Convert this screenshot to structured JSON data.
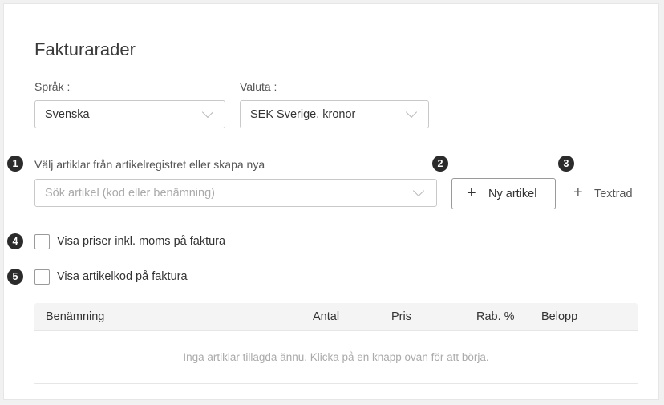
{
  "title": "Fakturarader",
  "language": {
    "label": "Språk :",
    "value": "Svenska"
  },
  "currency": {
    "label": "Valuta :",
    "value": "SEK Sverige, kronor"
  },
  "steps": [
    "1",
    "2",
    "3",
    "4",
    "5"
  ],
  "article": {
    "label": "Välj artiklar från artikelregistret eller skapa nya",
    "placeholder": "Sök artikel (kod eller benämning)"
  },
  "buttons": {
    "new_article_icon": "+",
    "new_article": "Ny artikel",
    "text_row_icon": "+",
    "text_row": "Textrad"
  },
  "checkboxes": {
    "show_vat": "Visa priser inkl. moms på faktura",
    "show_code": "Visa artikelkod på faktura"
  },
  "table": {
    "columns": [
      "Benämning",
      "Antal",
      "Pris",
      "Rab. %",
      "Belopp"
    ],
    "empty_message": "Inga artiklar tillagda ännu. Klicka på en knapp ovan för att börja."
  }
}
